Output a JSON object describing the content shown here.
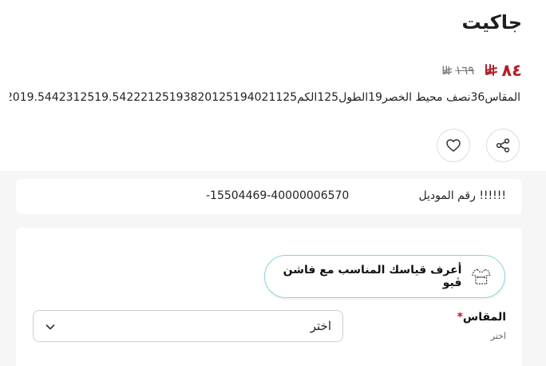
{
  "product": {
    "title": "جاكيت",
    "price_current": "٨٤",
    "price_original": "١٦٩",
    "description": "المقاس36نصف محيط الخصر19الطول125الكم193820125194021125‏19.54222125‏19.54423125‏20"
  },
  "model": {
    "label": "!!!!!! رقم الموديل",
    "value": "-15504469-40000006570"
  },
  "fit_finder": {
    "label": "أعرف قياسك المناسب مع فاشن ڤيو"
  },
  "size": {
    "label": "المقاس",
    "required_mark": "*",
    "hint": "اختر",
    "selected": "اختر"
  },
  "icons": {
    "share": "share-icon",
    "wishlist": "heart-icon",
    "chevron": "chevron-down-icon",
    "fit": "tshirt-measure-icon",
    "currency": "riyal-icon"
  },
  "colors": {
    "price": "#b3202a",
    "accent_border": "#8ad3d7",
    "required": "#c8102e"
  }
}
